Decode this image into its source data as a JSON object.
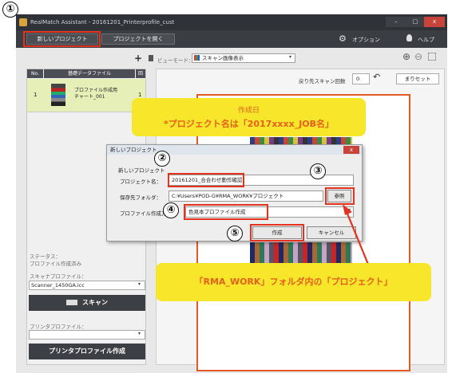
{
  "app": {
    "title": "RealMatch Assistant - 20161201_Printerprofile_cust",
    "window_controls": [
      "–",
      "□",
      "x"
    ]
  },
  "toolbar": {
    "new_project": "新しいプロジェクト",
    "open_project": "プロジェクトを開く",
    "options": "オプション",
    "help": "ヘルプ"
  },
  "view": {
    "view_mode_label": "ビューモード：",
    "view_mode_value": "スキャン画像表示",
    "return_label": "戻り先スキャン回数",
    "return_value": "0",
    "reset": "まりセット"
  },
  "table": {
    "headers": [
      "No.",
      "基礎データファイル",
      "回"
    ],
    "rows": [
      {
        "no": "1",
        "name": "プロファイル作成用\nチャート_001",
        "count": "1"
      }
    ]
  },
  "left": {
    "status_label": "ステータス：",
    "status_value": "プロファイル作成済み",
    "scanner_label": "スキャナプロファイル：",
    "scanner_value": "Scanner_1450GA.icc",
    "scan_button": "スキャン",
    "printer_label": "プリンタプロファイル：",
    "printer_value": "",
    "create_printer_button": "プリンタプロファイル作成"
  },
  "dialog": {
    "title": "新しいプロジェクト",
    "section_label": "新しいプロジェクト",
    "project_name_label": "プロジェクト名：",
    "project_name_value": "20161201_合合わせ動作確認",
    "folder_label": "保存先フォルダ：",
    "folder_value": "C:¥Users¥POD-G¥RMA_WORK¥プロジェクト",
    "browse": "参照",
    "type_label": "プロファイル作成方式：",
    "type_value": "色見本プロファイル作成",
    "create": "作成",
    "cancel": "キャンセル"
  },
  "callouts": {
    "top_line1": "作成日",
    "top_line2": "*プロジェクト名は「2017xxxx_JOB名」",
    "bottom": "「RMA_WORK」フォルダ内の「プロジェクト」"
  },
  "steps": [
    "①",
    "②",
    "③",
    "④",
    "⑤"
  ],
  "page_partial_text": "ToSHI",
  "colors": {
    "accent_red": "#e3331f",
    "callout_yellow": "#f8e62a",
    "callout_text": "#e8601c",
    "selected_row": "#e7efb8"
  }
}
